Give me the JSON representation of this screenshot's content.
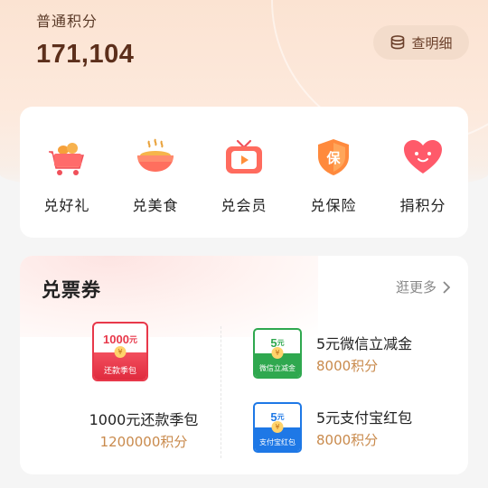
{
  "header": {
    "points_label": "普通积分",
    "points_value": "171,104",
    "detail_button": "查明细"
  },
  "categories": [
    {
      "label": "兑好礼",
      "icon": "shopping-cart-icon"
    },
    {
      "label": "兑美食",
      "icon": "food-bowl-icon"
    },
    {
      "label": "兑会员",
      "icon": "tv-play-icon"
    },
    {
      "label": "兑保险",
      "icon": "insurance-shield-icon"
    },
    {
      "label": "捐积分",
      "icon": "heart-icon"
    }
  ],
  "vouchers": {
    "title": "兑票券",
    "more_label": "逛更多",
    "featured": {
      "badge_amount": "1000",
      "badge_unit": "元",
      "coin_symbol": "¥",
      "badge_caption": "还款季包",
      "name": "1000元还款季包",
      "points": "1200000积分"
    },
    "items": [
      {
        "badge_amount": "5",
        "badge_unit": "元",
        "coin_symbol": "¥",
        "badge_caption": "微信立减金",
        "name": "5元微信立减金",
        "points": "8000积分",
        "color": "#2fa84f"
      },
      {
        "badge_amount": "5",
        "badge_unit": "元",
        "coin_symbol": "¥",
        "badge_caption": "支付宝红包",
        "name": "5元支付宝红包",
        "points": "8000积分",
        "color": "#1e78e6"
      }
    ]
  },
  "colors": {
    "accent_red": "#e8384a",
    "points_brown": "#5c2f1b",
    "points_gold": "#c98a4c"
  }
}
